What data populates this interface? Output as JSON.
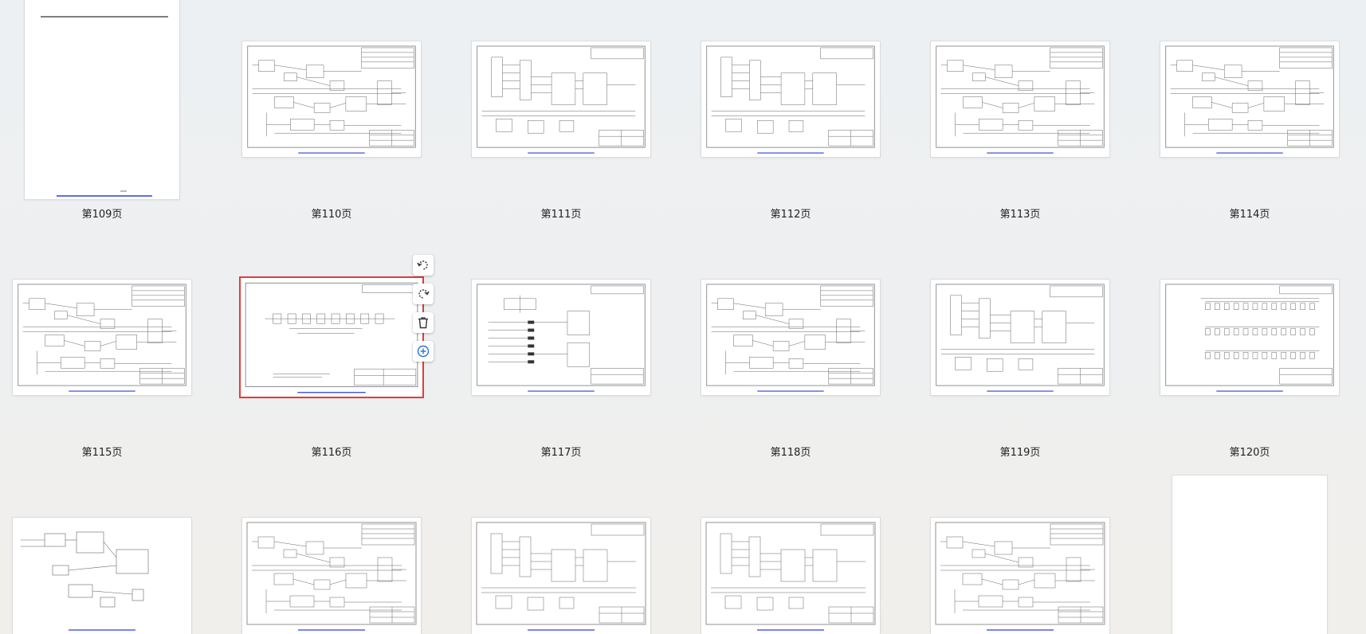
{
  "pages": [
    {
      "label": "第109页"
    },
    {
      "label": "第110页"
    },
    {
      "label": "第111页"
    },
    {
      "label": "第112页"
    },
    {
      "label": "第113页"
    },
    {
      "label": "第114页"
    },
    {
      "label": "第115页"
    },
    {
      "label": "第116页"
    },
    {
      "label": "第117页"
    },
    {
      "label": "第118页"
    },
    {
      "label": "第119页"
    },
    {
      "label": "第120页"
    }
  ],
  "selected_page": "第116页",
  "page_tools": {
    "icons": [
      "rotate-left-icon",
      "rotate-right-icon",
      "delete-icon",
      "insert-page-icon"
    ]
  },
  "colors": {
    "selection": "#e33b3b",
    "tool_icon": "#333333",
    "insert_icon": "#2f6fd6",
    "footer_link": "#2a3de0"
  }
}
